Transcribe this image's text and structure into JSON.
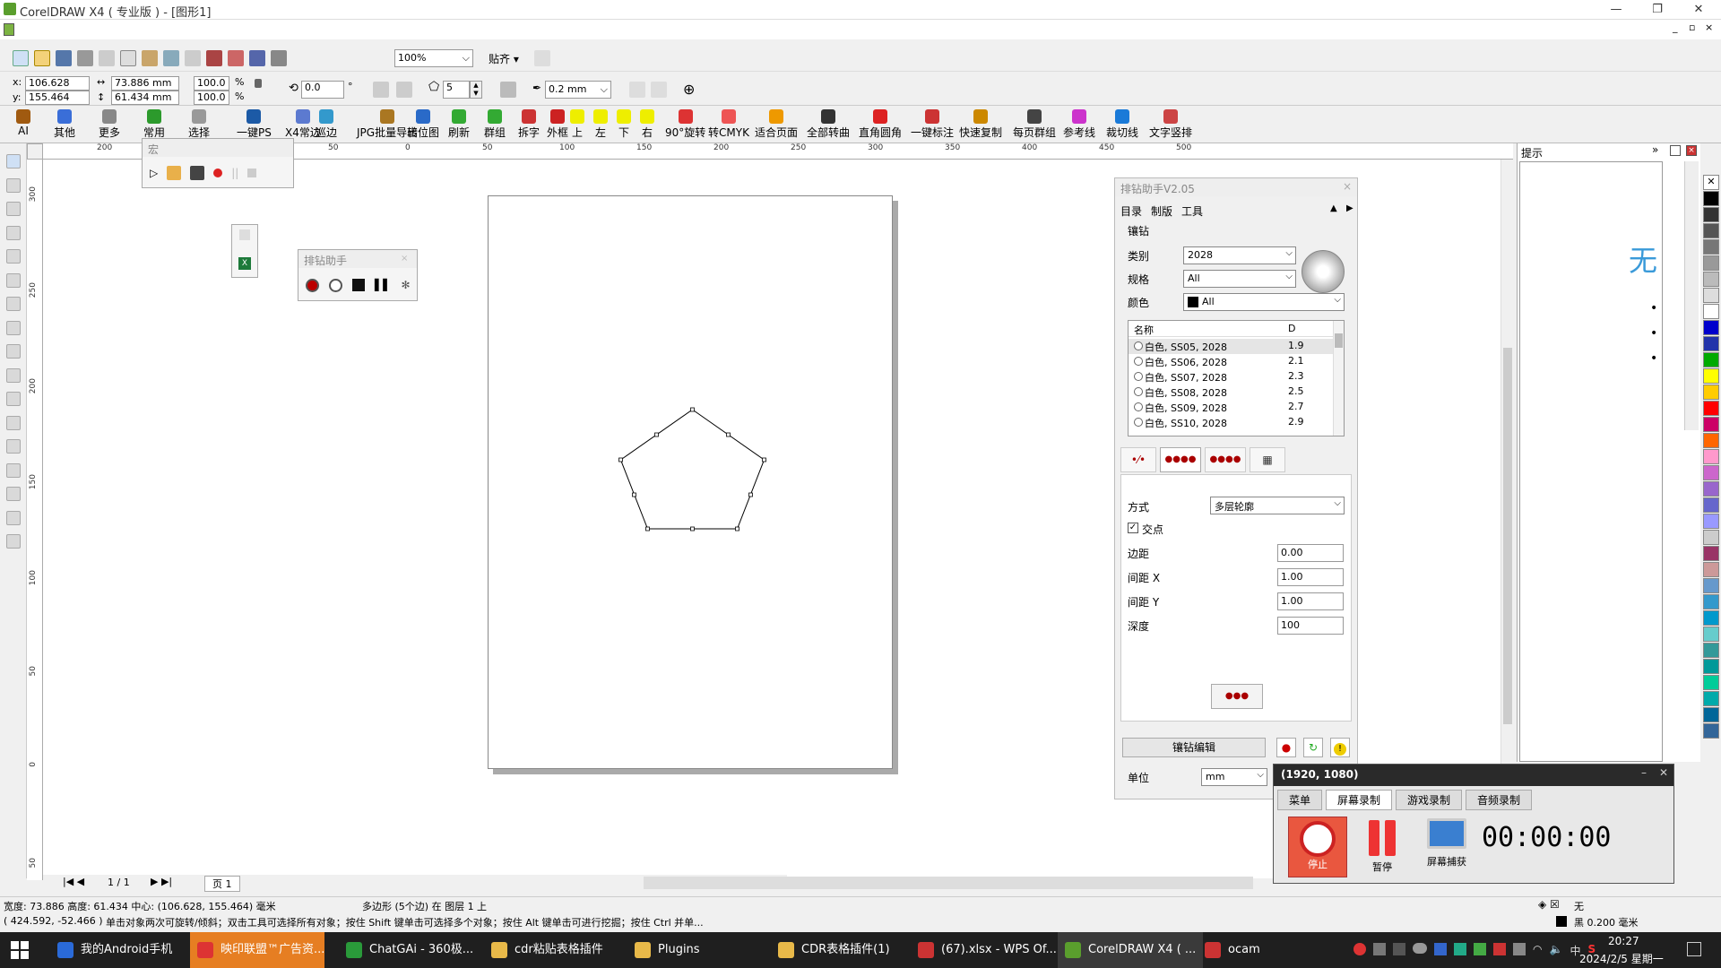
{
  "window": {
    "title": "CorelDRAW X4 ( 专业版 ) - [图形1]"
  },
  "toolbar": {
    "zoom": "100%",
    "snap": "贴齐"
  },
  "props": {
    "x": "106.628 mm",
    "y": "155.464 mm",
    "w": "73.886 mm",
    "h": "61.434 mm",
    "sx": "100.0",
    "sy": "100.0",
    "pct": "%",
    "rot": "0.0",
    "sides": "5",
    "outline": "0.2 mm"
  },
  "plugins": [
    "AI",
    "其他",
    "更多",
    "常用",
    "选择",
    "一键PS",
    "X4常边",
    "巡边",
    "JPG批量导出",
    "转位图",
    "刷新",
    "群组",
    "拆字",
    "外框",
    "上",
    "左",
    "下",
    "右",
    "90°旋转",
    "转CMYK",
    "适合页面",
    "全部转曲",
    "直角圆角",
    "一键标注",
    "快速复制",
    "每页群组",
    "参考线",
    "裁切线",
    "文字竖排"
  ],
  "ruler_h": [
    "200",
    "150",
    "100",
    "50",
    "0",
    "50",
    "100",
    "150",
    "200",
    "250",
    "300",
    "350",
    "400",
    "450",
    "500"
  ],
  "ruler_v": [
    "300",
    "250",
    "200",
    "150",
    "100",
    "50",
    "0",
    "50"
  ],
  "macro_panel": {
    "title": "宏"
  },
  "mini_helper": {
    "title": "排钻助手"
  },
  "helper": {
    "title": "排钻助手V2.05",
    "menu": [
      "目录",
      "制版",
      "工具"
    ],
    "section": "镶钻",
    "category_label": "类别",
    "category": "2028",
    "spec_label": "规格",
    "spec": "All",
    "color_label": "颜色",
    "color": "All",
    "list_headers": [
      "名称",
      "D"
    ],
    "list": [
      {
        "name": "白色, SS05, 2028",
        "d": "1.9"
      },
      {
        "name": "白色, SS06, 2028",
        "d": "2.1"
      },
      {
        "name": "白色, SS07, 2028",
        "d": "2.3"
      },
      {
        "name": "白色, SS08, 2028",
        "d": "2.5"
      },
      {
        "name": "白色, SS09, 2028",
        "d": "2.7"
      },
      {
        "name": "白色, SS10, 2028",
        "d": "2.9"
      }
    ],
    "mode_label": "方式",
    "mode": "多层轮廓",
    "intersect_label": "交点",
    "margin_label": "边距",
    "margin": "0.00",
    "gapx_label": "间距 X",
    "gapx": "1.00",
    "gapy_label": "间距 Y",
    "gapy": "1.00",
    "depth_label": "深度",
    "depth": "100",
    "edit_button": "镶钻编辑",
    "unit_label": "单位",
    "unit": "mm",
    "help": "?"
  },
  "hint_panel": {
    "title": "提示",
    "text": "无"
  },
  "ocam": {
    "title": "(1920, 1080)",
    "tabs": [
      "菜单",
      "屏幕录制",
      "游戏录制",
      "音频录制"
    ],
    "stop": "停止",
    "pause": "暂停",
    "capture": "屏幕捕获",
    "timer": "00:00:00"
  },
  "pagebar": {
    "pages": "1 / 1",
    "tab": "页 1"
  },
  "status": {
    "line1": "宽度: 73.886  高度: 61.434  中心: (106.628, 155.464)  毫米",
    "object": "多边形 (5个边) 在 图层 1 上",
    "coords": "( 424.592, -52.466 )",
    "hint": "单击对象两次可旋转/倾斜；双击工具可选择所有对象；按住 Shift 键单击可选择多个对象；按住 Alt 键单击可进行挖掘；按住 Ctrl 并单...",
    "fill": "无",
    "outline": "黑  0.200 毫米"
  },
  "taskbar": {
    "items": [
      "我的Android手机",
      "映印联盟™广告资...",
      "ChatGAi - 360极...",
      "cdr粘贴表格插件",
      "Plugins",
      "CDR表格插件(1)",
      "(67).xlsx - WPS Of...",
      "CorelDRAW X4 ( ...",
      "ocam"
    ],
    "time": "20:27",
    "date": "2024/2/5 星期一",
    "ime": "中"
  },
  "palette": [
    "#ffffff",
    "#000000",
    "#333333",
    "#555555",
    "#777777",
    "#999999",
    "#bbbbbb",
    "#dddddd",
    "#ffffff",
    "#0000cc",
    "#2233aa",
    "#00aa00",
    "#ffff00",
    "#ffcc00",
    "#ff0000",
    "#cc0066",
    "#ff6600",
    "#ff99cc",
    "#cc66cc",
    "#9966cc",
    "#6666cc",
    "#9999ff",
    "#cccccc",
    "#993366",
    "#cc9999",
    "#6699cc",
    "#3399cc",
    "#0099cc",
    "#66cccc",
    "#339999",
    "#009999",
    "#00cc99",
    "#00aaaa",
    "#006699",
    "#336699"
  ]
}
